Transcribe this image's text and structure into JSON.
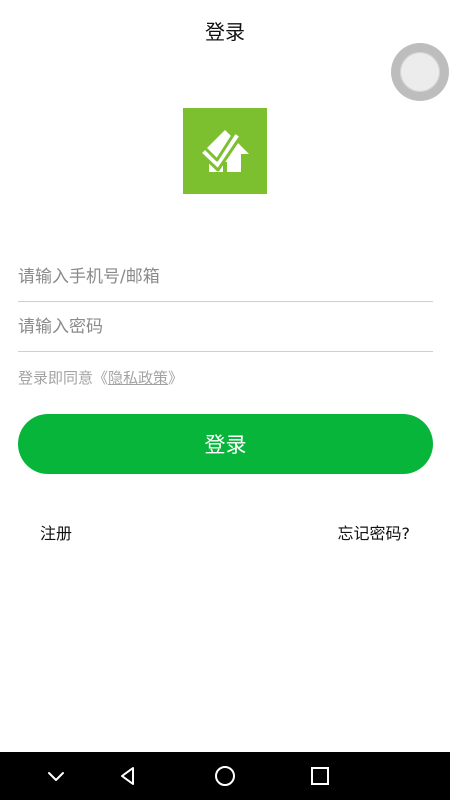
{
  "header": {
    "title": "登录"
  },
  "form": {
    "phone_placeholder": "请输入手机号/邮箱",
    "password_placeholder": "请输入密码",
    "agree_prefix": "登录即同意《",
    "privacy_link": "隐私政策",
    "agree_suffix": "》",
    "login_label": "登录"
  },
  "links": {
    "register": "注册",
    "forgot": "忘记密码?"
  },
  "colors": {
    "brand_green": "#7cbf2f",
    "button_green": "#07b53a"
  },
  "icons": {
    "logo": "house-check-logo",
    "floating": "floating-ball-icon",
    "nav": [
      "chevron-down-icon",
      "back-triangle-icon",
      "home-circle-icon",
      "recent-square-icon"
    ]
  }
}
